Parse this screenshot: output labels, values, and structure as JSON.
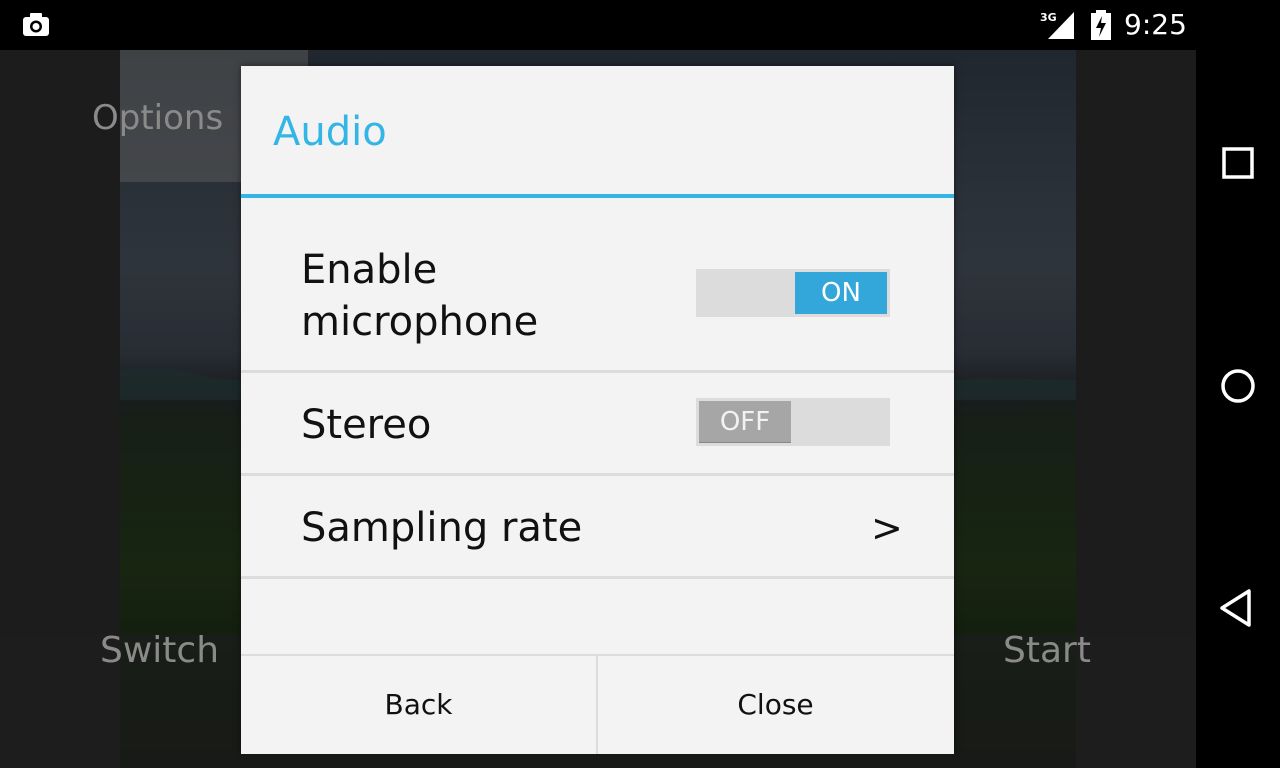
{
  "status_bar": {
    "time": "9:25",
    "network": "3G",
    "icons": [
      "camera-icon",
      "signal-icon",
      "battery-charging-icon"
    ]
  },
  "background_app": {
    "options_label": "Options",
    "switch_label": "Switch",
    "start_label": "Start"
  },
  "dialog": {
    "title": "Audio",
    "accent_color": "#33b5e5",
    "preferences": [
      {
        "label": "Enable microphone",
        "type": "switch",
        "state_label": "ON",
        "checked": true
      },
      {
        "label": "Stereo",
        "type": "switch",
        "state_label": "OFF",
        "checked": false
      },
      {
        "label": "Sampling rate",
        "type": "navigate",
        "arrow": ">"
      }
    ],
    "buttons": {
      "back": "Back",
      "close": "Close"
    }
  },
  "nav_bar": {
    "icons": [
      "recent-apps-icon",
      "home-icon",
      "back-icon"
    ]
  }
}
